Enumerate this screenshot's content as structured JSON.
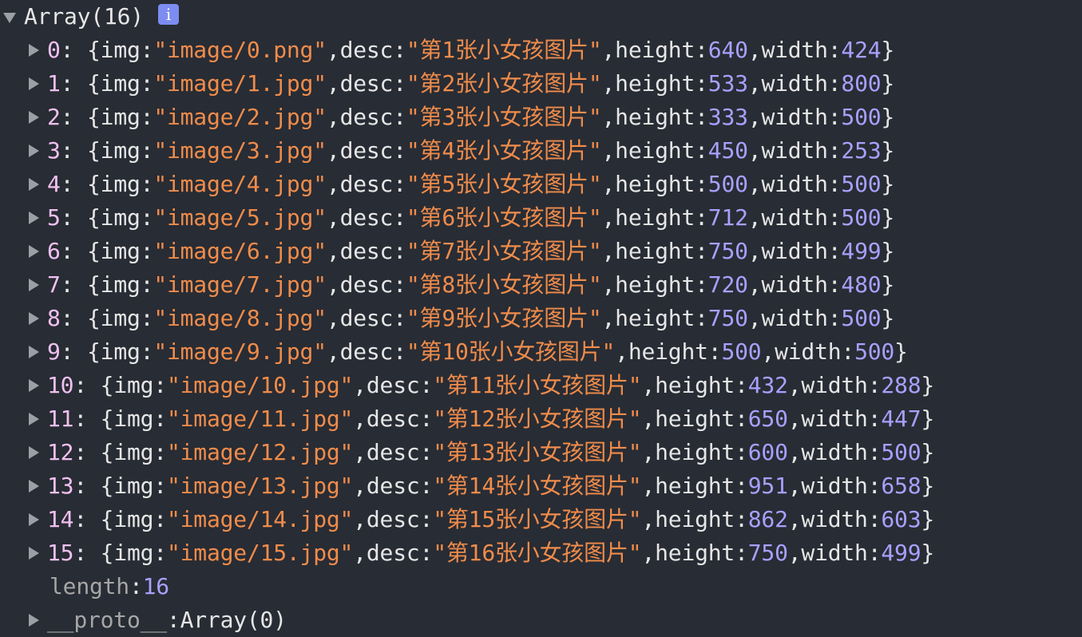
{
  "console": {
    "root_label": "Array(16)",
    "info_icon": "info-icon",
    "items": [
      {
        "index": "0",
        "img": "image/0.png",
        "desc": "第1张小女孩图片",
        "height": "640",
        "width": "424"
      },
      {
        "index": "1",
        "img": "image/1.jpg",
        "desc": "第2张小女孩图片",
        "height": "533",
        "width": "800"
      },
      {
        "index": "2",
        "img": "image/2.jpg",
        "desc": "第3张小女孩图片",
        "height": "333",
        "width": "500"
      },
      {
        "index": "3",
        "img": "image/3.jpg",
        "desc": "第4张小女孩图片",
        "height": "450",
        "width": "253"
      },
      {
        "index": "4",
        "img": "image/4.jpg",
        "desc": "第5张小女孩图片",
        "height": "500",
        "width": "500"
      },
      {
        "index": "5",
        "img": "image/5.jpg",
        "desc": "第6张小女孩图片",
        "height": "712",
        "width": "500"
      },
      {
        "index": "6",
        "img": "image/6.jpg",
        "desc": "第7张小女孩图片",
        "height": "750",
        "width": "499"
      },
      {
        "index": "7",
        "img": "image/7.jpg",
        "desc": "第8张小女孩图片",
        "height": "720",
        "width": "480"
      },
      {
        "index": "8",
        "img": "image/8.jpg",
        "desc": "第9张小女孩图片",
        "height": "750",
        "width": "500"
      },
      {
        "index": "9",
        "img": "image/9.jpg",
        "desc": "第10张小女孩图片",
        "height": "500",
        "width": "500"
      },
      {
        "index": "10",
        "img": "image/10.jpg",
        "desc": "第11张小女孩图片",
        "height": "432",
        "width": "288"
      },
      {
        "index": "11",
        "img": "image/11.jpg",
        "desc": "第12张小女孩图片",
        "height": "650",
        "width": "447"
      },
      {
        "index": "12",
        "img": "image/12.jpg",
        "desc": "第13张小女孩图片",
        "height": "600",
        "width": "500"
      },
      {
        "index": "13",
        "img": "image/13.jpg",
        "desc": "第14张小女孩图片",
        "height": "951",
        "width": "658"
      },
      {
        "index": "14",
        "img": "image/14.jpg",
        "desc": "第15张小女孩图片",
        "height": "862",
        "width": "603"
      },
      {
        "index": "15",
        "img": "image/15.jpg",
        "desc": "第16张小女孩图片",
        "height": "750",
        "width": "499"
      }
    ],
    "length_label": "length",
    "length_value": "16",
    "proto_label": "__proto__",
    "proto_value": "Array(0)"
  },
  "colors": {
    "background": "#282c34",
    "string": "#f08c4b",
    "number": "#a9a0ff",
    "text": "#e6e6e6",
    "dim": "#a6a6a6",
    "info_badge": "#7c8cf0"
  }
}
